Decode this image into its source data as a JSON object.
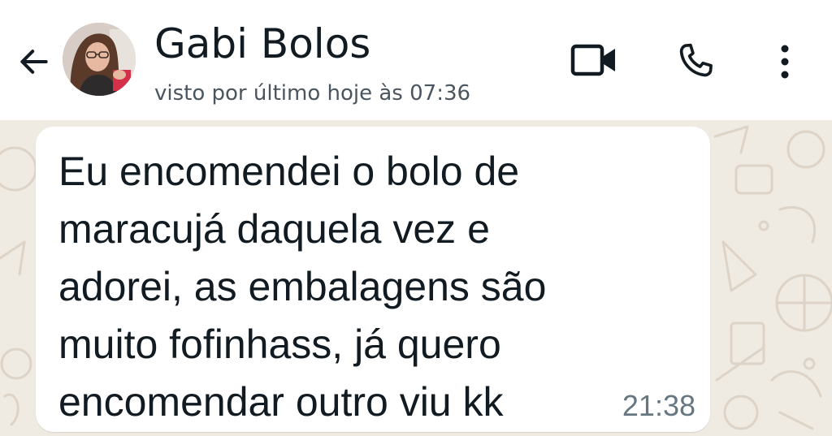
{
  "contact": {
    "name": "Gabi Bolos",
    "status": "visto por último hoje às 07:36"
  },
  "icons": {
    "back": "arrow-left-icon",
    "video": "video-camera-icon",
    "call": "phone-icon",
    "menu": "more-vertical-icon"
  },
  "colors": {
    "header_bg": "#ffffff",
    "chat_bg": "#efeae2",
    "bubble_bg": "#ffffff",
    "text": "#111b21",
    "timestamp": "#667781"
  },
  "message": {
    "text": "Eu encomendei o bolo de\nmaracujá daquela vez e\nadorei, as embalagens são\nmuito fofinhass, já quero\nencomendar outro viu kk",
    "time": "21:38"
  }
}
